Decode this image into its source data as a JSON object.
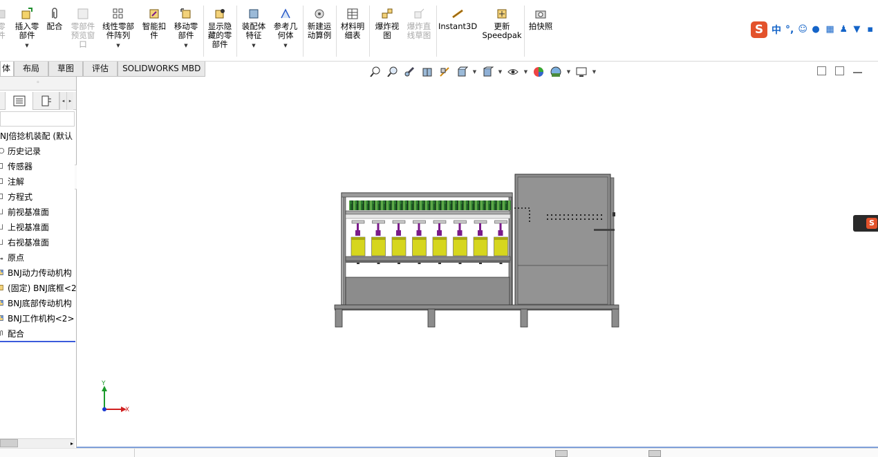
{
  "ribbon": {
    "buttons": [
      {
        "label": "零\n件",
        "disabled": true
      },
      {
        "label": "插入零\n部件",
        "dropdown": true
      },
      {
        "label": "配合"
      },
      {
        "label": "零部件\n预览窗\n口",
        "disabled": true
      },
      {
        "label": "线性零部\n件阵列",
        "dropdown": true
      },
      {
        "label": "智能扣\n件"
      },
      {
        "label": "移动零\n部件",
        "dropdown": true
      },
      {
        "label": "显示隐\n藏的零\n部件"
      },
      {
        "label": "装配体\n特征",
        "dropdown": true
      },
      {
        "label": "参考几\n何体",
        "dropdown": true
      },
      {
        "label": "新建运\n动算例"
      },
      {
        "label": "材料明\n细表"
      },
      {
        "label": "爆炸视\n图"
      },
      {
        "label": "爆炸直\n线草图",
        "disabled": true
      },
      {
        "label": "Instant3D"
      },
      {
        "label": "更新\nSpeedpak"
      },
      {
        "label": "拍快照"
      }
    ]
  },
  "ime": {
    "logo": "S",
    "mode": "中",
    "punct": "°,"
  },
  "tabs": [
    "体",
    "布局",
    "草图",
    "评估",
    "SOLIDWORKS MBD"
  ],
  "active_tab": "体",
  "tree": {
    "root": "NJ倍捻机装配 (默认",
    "items": [
      {
        "label": "历史记录",
        "icon": "history-icon"
      },
      {
        "label": "传感器",
        "icon": "sensor-icon"
      },
      {
        "label": "注解",
        "icon": "annotation-icon"
      },
      {
        "label": "方程式",
        "icon": "equation-icon"
      },
      {
        "label": "前视基准面",
        "icon": "plane-icon"
      },
      {
        "label": "上视基准面",
        "icon": "plane-icon"
      },
      {
        "label": "右视基准面",
        "icon": "plane-icon"
      },
      {
        "label": "原点",
        "icon": "origin-icon"
      },
      {
        "label": "BNJ动力传动机构",
        "icon": "subassembly-icon"
      },
      {
        "label": "(固定) BNJ底框<2",
        "icon": "part-icon"
      },
      {
        "label": "BNJ底部传动机构",
        "icon": "subassembly-icon"
      },
      {
        "label": "BNJ工作机构<2>",
        "icon": "subassembly-icon"
      },
      {
        "label": "配合",
        "icon": "mates-icon"
      }
    ]
  },
  "triad": {
    "y_label": "Y",
    "x_label": "X"
  },
  "colors": {
    "accent": "#3b5bdb",
    "ime": "#e3522b",
    "model_body": "#8c8c8c",
    "bobbin": "#d6d61e",
    "spindle": "#7a1a8a",
    "creel_green": "#2e7d32"
  }
}
